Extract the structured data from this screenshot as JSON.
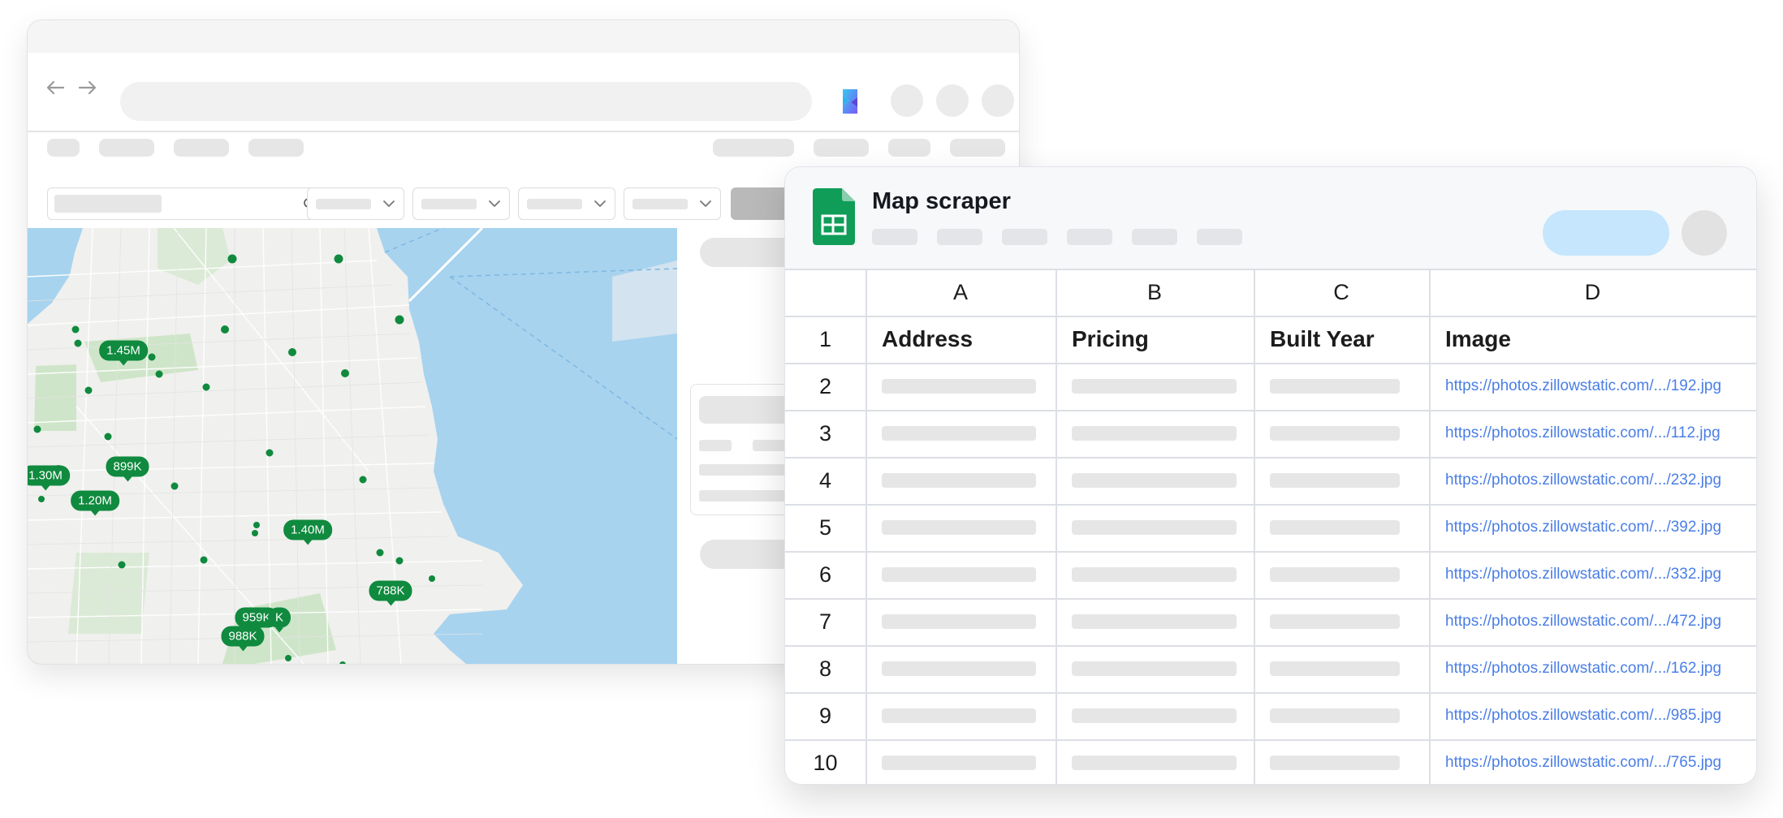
{
  "map": {
    "price_labels": [
      "1.45M",
      "899K",
      "1.30M",
      "1.20M",
      "1.40M",
      "788K",
      "959K",
      "K",
      "988K"
    ]
  },
  "sheet": {
    "title": "Map scraper",
    "columns": [
      "A",
      "B",
      "C",
      "D"
    ],
    "header_row": {
      "number": "1",
      "fields": [
        "Address",
        "Pricing",
        "Built Year",
        "Image"
      ]
    },
    "rows": [
      {
        "number": "2",
        "image": "https://photos.zillowstatic.com/.../192.jpg"
      },
      {
        "number": "3",
        "image": "https://photos.zillowstatic.com/.../112.jpg"
      },
      {
        "number": "4",
        "image": "https://photos.zillowstatic.com/.../232.jpg"
      },
      {
        "number": "5",
        "image": "https://photos.zillowstatic.com/.../392.jpg"
      },
      {
        "number": "6",
        "image": "https://photos.zillowstatic.com/.../332.jpg"
      },
      {
        "number": "7",
        "image": "https://photos.zillowstatic.com/.../472.jpg"
      },
      {
        "number": "8",
        "image": "https://photos.zillowstatic.com/.../162.jpg"
      },
      {
        "number": "9",
        "image": "https://photos.zillowstatic.com/.../985.jpg"
      },
      {
        "number": "10",
        "image": "https://photos.zillowstatic.com/.../765.jpg"
      }
    ]
  },
  "colors": {
    "marker": "#0f8a3e",
    "water": "#a7d3ef",
    "link": "#4a7ee6",
    "sheets_green": "#0f9d58"
  },
  "icons": [
    "arrow-left-icon",
    "arrow-right-icon",
    "brand-logo-icon",
    "search-icon",
    "chevron-down-icon",
    "google-sheets-icon"
  ]
}
